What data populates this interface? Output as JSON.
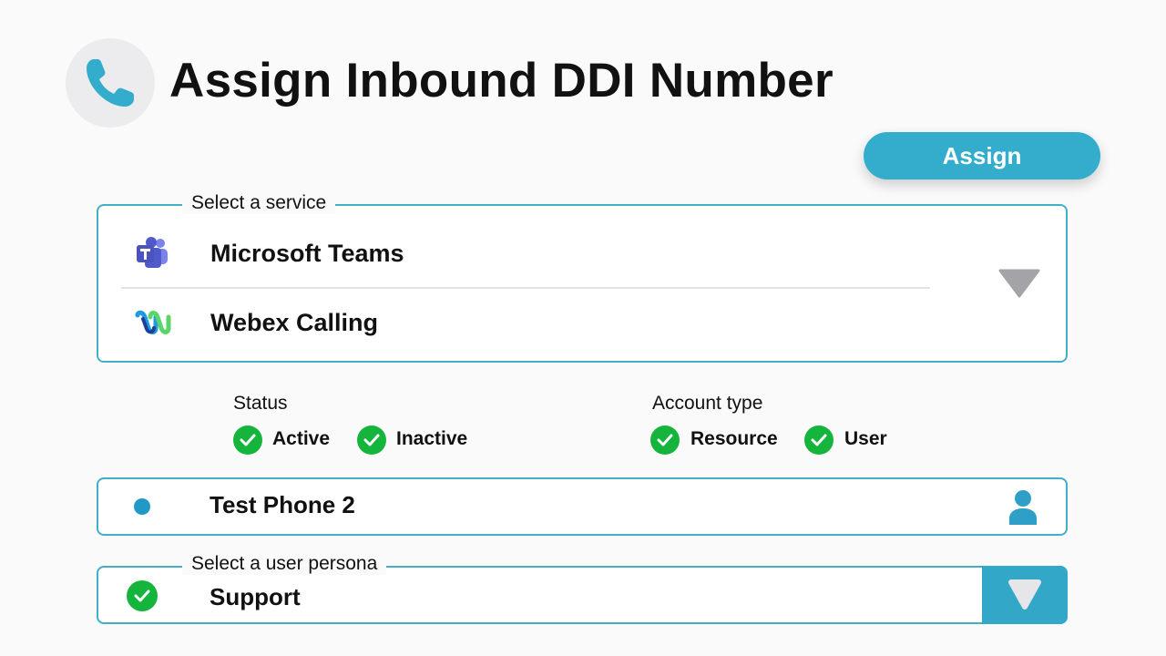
{
  "header": {
    "title": "Assign Inbound DDI Number",
    "icon": "phone-icon"
  },
  "assign_button": {
    "label": "Assign",
    "color": "#34adcc"
  },
  "service_select": {
    "legend": "Select a service",
    "options": [
      {
        "label": "Microsoft Teams",
        "icon": "microsoft-teams-icon"
      },
      {
        "label": "Webex Calling",
        "icon": "webex-icon"
      }
    ],
    "dropdown_icon": "chevron-down-icon"
  },
  "filters": {
    "status": {
      "heading": "Status",
      "options": [
        {
          "label": "Active",
          "checked": true
        },
        {
          "label": "Inactive",
          "checked": true
        }
      ]
    },
    "account_type": {
      "heading": "Account type",
      "options": [
        {
          "label": "Resource",
          "checked": true
        },
        {
          "label": "User",
          "checked": true
        }
      ]
    }
  },
  "phone_entry": {
    "name": "Test Phone 2",
    "icon": "user-icon",
    "dot_color": "#2199c7"
  },
  "persona_select": {
    "legend": "Select a user persona",
    "value": "Support",
    "checked": true,
    "dropdown_icon": "triangle-down-icon"
  },
  "colors": {
    "accent": "#34adcc",
    "border": "#41afc8",
    "check_green": "#15b53d"
  }
}
